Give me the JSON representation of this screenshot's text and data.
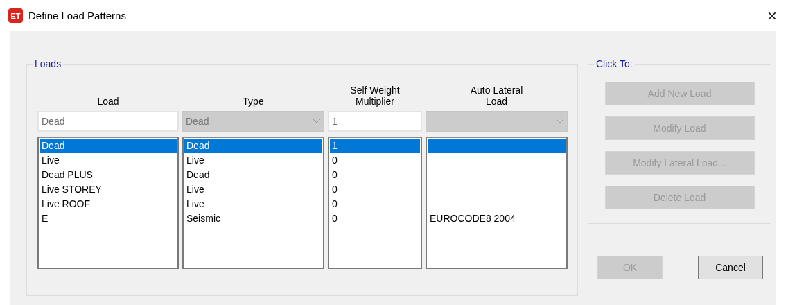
{
  "window": {
    "title": "Define Load Patterns",
    "icon_text": "ET",
    "close": "×"
  },
  "loads_group": {
    "title": "Loads",
    "columns": [
      {
        "header": "Load",
        "kind": "text",
        "value": "Dead",
        "disabled": false
      },
      {
        "header": "Type",
        "kind": "combo",
        "value": "Dead",
        "disabled": true
      },
      {
        "header": "Self Weight Multiplier",
        "kind": "text",
        "value": "1",
        "disabled": false
      },
      {
        "header": "Auto Lateral Load",
        "kind": "combo",
        "disabled": true
      }
    ],
    "rows": [
      {
        "load": "Dead",
        "type": "Dead",
        "multiplier": "1",
        "selected": true
      },
      {
        "load": "Live",
        "type": "Live",
        "multiplier": "0",
        "selected": false
      },
      {
        "load": "Dead PLUS",
        "type": "Dead",
        "multiplier": "0",
        "selected": false
      },
      {
        "load": "Live STOREY",
        "type": "Live",
        "multiplier": "0",
        "selected": false
      },
      {
        "load": "Live ROOF",
        "type": "Live",
        "multiplier": "0",
        "selected": false
      },
      {
        "load": "E",
        "type": "Seismic",
        "multiplier": "0",
        "lateral": "EUROCODE8 2004",
        "selected": false
      }
    ]
  },
  "click_to_group": {
    "title": "Click To:",
    "buttons": [
      {
        "label": "Add New Load",
        "disabled": true
      },
      {
        "label": "Modify Load",
        "disabled": true
      },
      {
        "label": "Modify Lateral Load...",
        "disabled": true
      },
      {
        "label": "Delete Load",
        "disabled": true
      }
    ]
  },
  "dialog_buttons": [
    {
      "label": "OK",
      "disabled": true
    },
    {
      "label": "Cancel",
      "disabled": false
    }
  ]
}
